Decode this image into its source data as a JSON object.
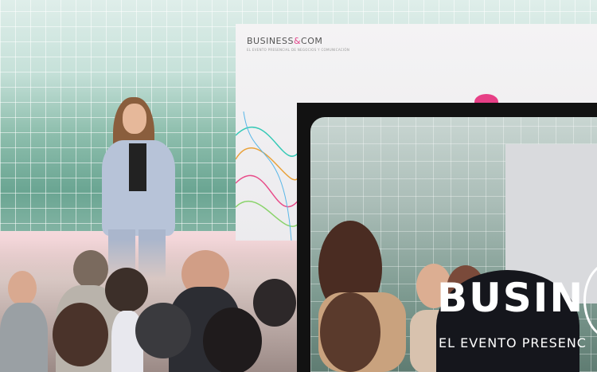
{
  "main_photo": {
    "screen": {
      "brand_text": "BUSINESS",
      "brand_amp": "&",
      "brand_suffix": "COM",
      "brand_subtitle": "EL EVENTO PRESENCIAL DE NEGOCIOS Y COMUNICACIÓN"
    }
  },
  "overlay_photo": {
    "title": "BUSIN",
    "subtitle": "EL EVENTO PRESENC"
  },
  "colors": {
    "brand_pink": "#e73f86",
    "tile_green": "#8fbfae"
  }
}
